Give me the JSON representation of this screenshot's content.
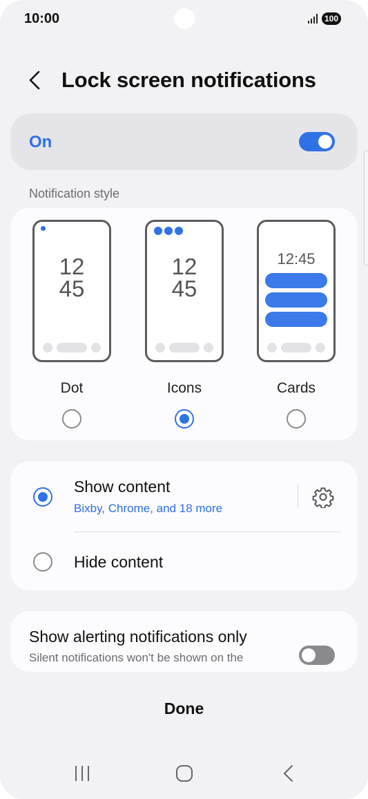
{
  "status": {
    "time": "10:00",
    "battery": "100"
  },
  "header": {
    "title": "Lock screen notifications"
  },
  "master_switch": {
    "label": "On",
    "enabled": true
  },
  "notification_style": {
    "section_label": "Notification style",
    "options": [
      {
        "name": "Dot",
        "clock": [
          "12",
          "45"
        ],
        "selected": false
      },
      {
        "name": "Icons",
        "clock": [
          "12",
          "45"
        ],
        "selected": true
      },
      {
        "name": "Cards",
        "clock": [
          "12:45"
        ],
        "selected": false
      }
    ]
  },
  "content": {
    "show_content": {
      "title": "Show content",
      "subtitle": "Bixby, Chrome, and 18 more",
      "selected": true
    },
    "hide_content": {
      "title": "Hide content",
      "selected": false
    }
  },
  "alerting": {
    "title": "Show alerting notifications only",
    "subtitle": "Silent notifications won't be shown on the",
    "enabled": false
  },
  "footer": {
    "done_label": "Done"
  },
  "colors": {
    "accent": "#2f72e6",
    "background": "#f2f2f4",
    "card": "#fcfcfe"
  },
  "icons": {
    "back": "chevron-left-icon",
    "settings": "gear-icon",
    "nav_recents": "recents-icon",
    "nav_home": "home-icon",
    "nav_back": "back-icon"
  }
}
